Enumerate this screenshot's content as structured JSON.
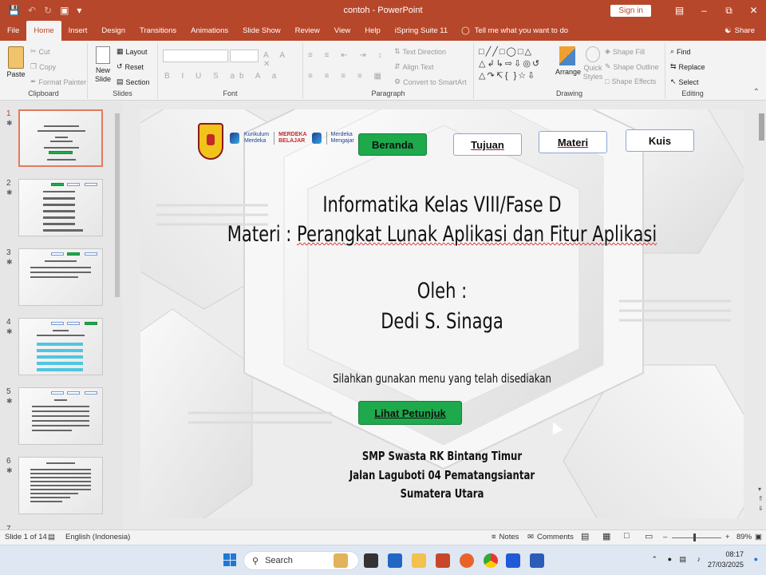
{
  "window": {
    "doc_title": "contoh  -  PowerPoint",
    "signin": "Sign in",
    "qat": [
      "save-icon",
      "undo-icon",
      "redo-icon",
      "present-icon",
      "customize-icon"
    ]
  },
  "tabs": [
    "File",
    "Home",
    "Insert",
    "Design",
    "Transitions",
    "Animations",
    "Slide Show",
    "Review",
    "View",
    "Help",
    "iSpring Suite 11"
  ],
  "tell_me": "Tell me what you want to do",
  "share": "Share",
  "ribbon": {
    "clipboard": {
      "label": "Clipboard",
      "paste": "Paste",
      "cut": "Cut",
      "copy": "Copy",
      "format_painter": "Format Painter"
    },
    "slides": {
      "label": "Slides",
      "new_slide": "New",
      "new_slide_2": "Slide",
      "layout": "Layout",
      "reset": "Reset",
      "section": "Section"
    },
    "font": {
      "label": "Font"
    },
    "paragraph": {
      "label": "Paragraph",
      "text_direction": "Text Direction",
      "align_text": "Align Text",
      "smartart": "Convert to SmartArt"
    },
    "drawing": {
      "label": "Drawing",
      "arrange": "Arrange",
      "quick_styles": "Quick",
      "quick_styles_2": "Styles",
      "shape_fill": "Shape Fill",
      "shape_outline": "Shape Outline",
      "shape_effects": "Shape Effects"
    },
    "editing": {
      "label": "Editing",
      "find": "Find",
      "replace": "Replace",
      "select": "Select"
    }
  },
  "thumbnails": [
    {
      "num": "1"
    },
    {
      "num": "2"
    },
    {
      "num": "3"
    },
    {
      "num": "4"
    },
    {
      "num": "5"
    },
    {
      "num": "6"
    },
    {
      "num": "7"
    }
  ],
  "slide": {
    "nav": {
      "beranda": "Beranda",
      "tujuan": "Tujuan",
      "materi": "Materi",
      "kuis": "Kuis"
    },
    "logos": {
      "kurikulum_1": "Kurikulum",
      "kurikulum_2": "Merdeka",
      "merdeka_1": "MERDEKA",
      "merdeka_2": "BELAJAR",
      "mengajar_1": "Merdeka",
      "mengajar_2": "Mengajar"
    },
    "title": "Informatika Kelas VIII/Fase D",
    "subtitle_prefix": "Materi : ",
    "subtitle": "Perangkat Lunak Aplikasi dan Fitur Aplikasi",
    "by_label": "Oleh :",
    "author": "Dedi S. Sinaga",
    "hint": "Silahkan gunakan menu yang telah disediakan",
    "guide_button": "Lihat Petunjuk",
    "school": "SMP Swasta RK Bintang Timur",
    "address": "Jalan Laguboti 04 Pematangsiantar",
    "region": "Sumatera Utara"
  },
  "status": {
    "slide": "Slide 1 of 14",
    "language": "English (Indonesia)",
    "notes": "Notes",
    "comments": "Comments",
    "zoom": "89%"
  },
  "taskbar": {
    "search": "Search",
    "time": "08:17",
    "date": "27/03/2025"
  },
  "colors": {
    "accent": "#b7472a",
    "nav_green": "#1ea94c"
  }
}
